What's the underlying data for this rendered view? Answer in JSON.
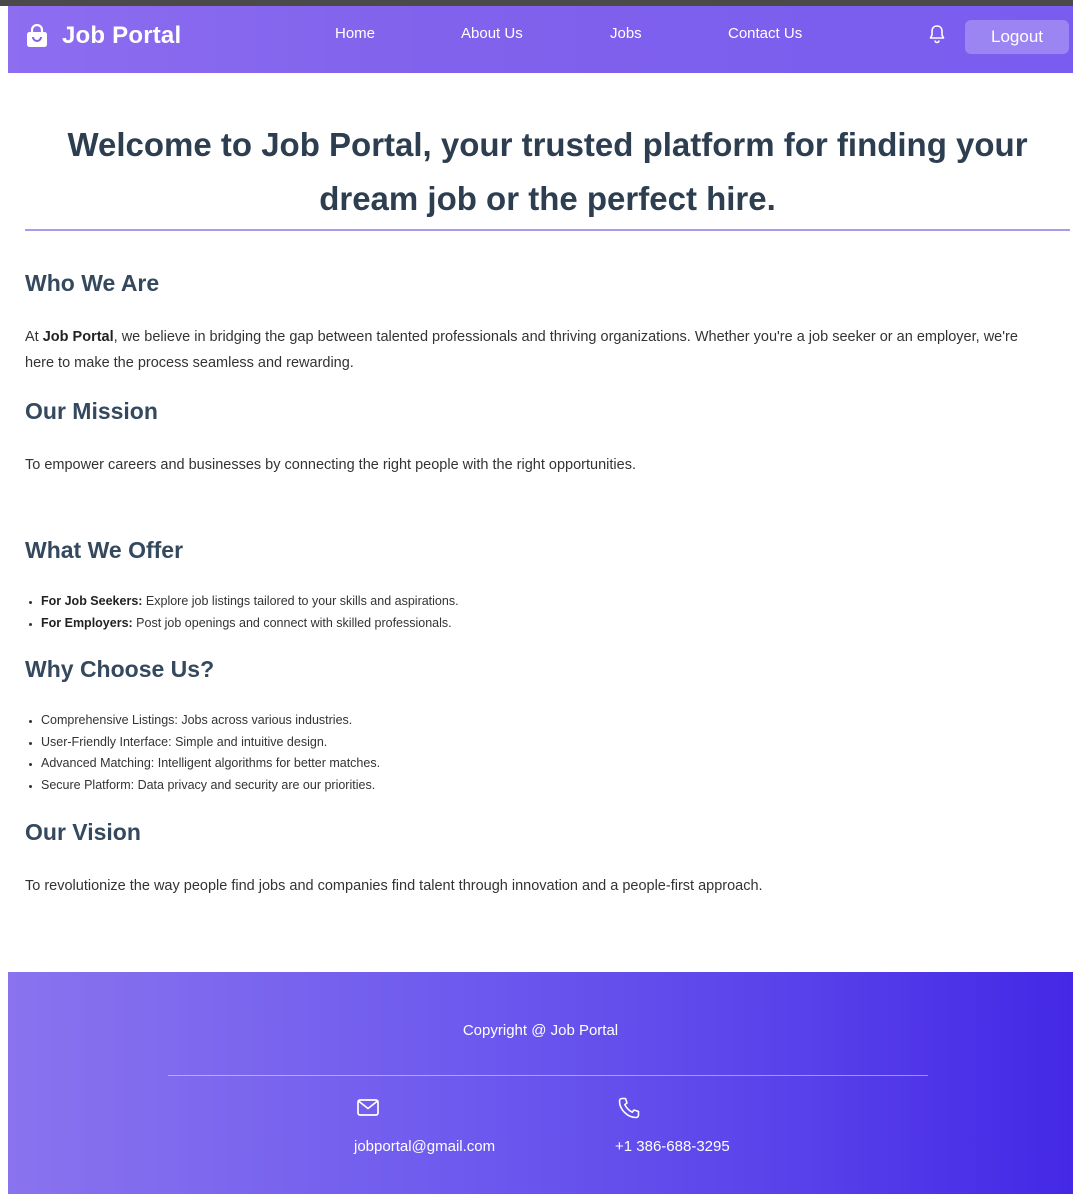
{
  "navbar": {
    "brand": "Job Portal",
    "brand_icon": "shopping-bag-icon",
    "links": [
      "Home",
      "About Us",
      "Jobs",
      "Contact Us"
    ],
    "notification_icon": "bell-icon",
    "logout_label": "Logout"
  },
  "hero": {
    "title": "Welcome to Job Portal, your trusted platform for finding your dream job or the perfect hire."
  },
  "sections": {
    "who_we_are": {
      "heading": "Who We Are",
      "prefix": "At ",
      "brand": "Job Portal",
      "text": ", we believe in bridging the gap between talented professionals and thriving organizations. Whether you're a job seeker or an employer, we're here to make the process seamless and rewarding."
    },
    "mission": {
      "heading": "Our Mission",
      "text": "To empower careers and businesses by connecting the right people with the right opportunities."
    },
    "offer": {
      "heading": "What We Offer",
      "items": [
        {
          "label": "For Job Seekers:",
          "text": " Explore job listings tailored to your skills and aspirations."
        },
        {
          "label": "For Employers:",
          "text": " Post job openings and connect with skilled professionals."
        }
      ]
    },
    "why": {
      "heading": "Why Choose Us?",
      "items": [
        "Comprehensive Listings: Jobs across various industries.",
        "User-Friendly Interface: Simple and intuitive design.",
        "Advanced Matching: Intelligent algorithms for better matches.",
        "Secure Platform: Data privacy and security are our priorities."
      ]
    },
    "vision": {
      "heading": "Our Vision",
      "text": "To revolutionize the way people find jobs and companies find talent through innovation and a people-first approach."
    }
  },
  "footer": {
    "copyright": "Copyright @ Job Portal",
    "email": "jobportal@gmail.com",
    "email_icon": "mail-icon",
    "phone": "+1 386-688-3295",
    "phone_icon": "phone-icon"
  },
  "colors": {
    "navbar": "#8062ec",
    "footer_start": "#8a73ee",
    "footer_end": "#4428e6",
    "heading": "#2c3e50",
    "rule": "#a99af0"
  }
}
